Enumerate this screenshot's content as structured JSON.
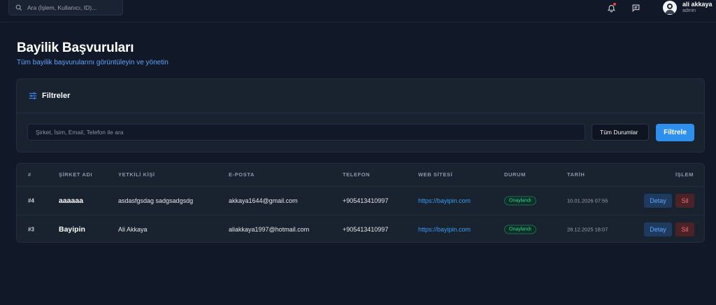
{
  "header": {
    "search_placeholder": "Ara (İşlem, Kullanıcı, ID)...",
    "user_name": "ali akkaya",
    "user_role": "admin"
  },
  "page": {
    "title": "Bayilik Başvuruları",
    "subtitle": "Tüm bayilik başvurularını görüntüleyin ve yönetin"
  },
  "filters": {
    "title": "Filtreler",
    "search_placeholder": "Şirket, İsim, Email, Telefon ile ara",
    "status_value": "Tüm Durumlar",
    "button_label": "Filtrele"
  },
  "table": {
    "headers": {
      "id": "#",
      "company": "ŞİRKET ADI",
      "contact": "YETKİLİ KİŞİ",
      "email": "E-POSTA",
      "phone": "TELEFON",
      "website": "WEB SİTESİ",
      "status": "DURUM",
      "date": "TARİH",
      "action": "İŞLEM"
    },
    "rows": [
      {
        "id": "#4",
        "company": "aaaaaa",
        "contact": "asdasfgsdag sadgsadgsdg",
        "email": "akkaya1644@gmail.com",
        "phone": "+905413410997",
        "website": "https://bayipin.com",
        "status": "Onaylandı",
        "date": "10.01.2026 07:55",
        "detail_label": "Detay",
        "delete_label": "Sil"
      },
      {
        "id": "#3",
        "company": "Bayipin",
        "contact": "Ali Akkaya",
        "email": "aliakkaya1997@hotmail.com",
        "phone": "+905413410997",
        "website": "https://bayipin.com",
        "status": "Onaylandı",
        "date": "28.12.2025 18:07",
        "detail_label": "Detay",
        "delete_label": "Sil"
      }
    ]
  },
  "colors": {
    "background": "#111827",
    "card": "#19222f",
    "accent": "#2f8fed",
    "link": "#3b9cf5",
    "success": "#34d399",
    "danger": "#f87171"
  },
  "icons": [
    "search-icon",
    "bell-icon",
    "message-icon",
    "avatar",
    "sliders-icon"
  ]
}
